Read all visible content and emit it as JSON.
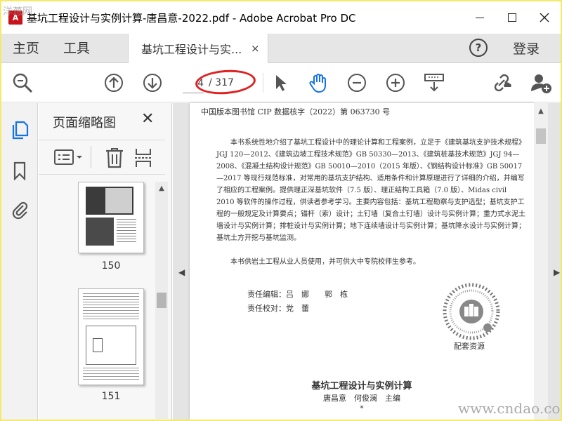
{
  "window": {
    "title": "基坑工程设计与实例计算-唐昌意-2022.pdf - Adobe Acrobat Pro DC",
    "app_icon_label": "A",
    "corner_logo": "洋葱网",
    "controls": [
      "minimize",
      "maximize",
      "close"
    ]
  },
  "menu": {
    "home": "主页",
    "tools": "工具",
    "active_tab": "基坑工程设计与实...",
    "tab_close": "×",
    "help": "?",
    "login": "登录"
  },
  "toolbar": {
    "page_current": "4",
    "page_total": "/ 317",
    "icons": [
      "zoom-search-icon",
      "page-up-icon",
      "page-down-icon",
      "select-arrow-icon",
      "hand-tool-icon",
      "zoom-out-icon",
      "zoom-in-icon",
      "keyboard-fit-icon",
      "share-link-icon",
      "add-user-icon"
    ]
  },
  "thumbnail_panel": {
    "title": "页面缩略图",
    "close": "✕",
    "pages": [
      "150",
      "151"
    ]
  },
  "page": {
    "cip": "中国版本图书馆 CIP 数据核字（2022）第 063730 号",
    "paragraph1": "本书系统性地介绍了基坑工程设计中的理论计算和工程案例，立足于《建筑基坑支护技术规程》JGJ 120—2012、《建筑边坡工程技术规范》GB 50330—2013、《建筑桩基技术规范》JGJ 94—2008、《混凝土结构设计规范》GB 50010—2010（2015 年版）、《钢结构设计标准》GB 50017—2017 等现行规范标准，对常用的基坑支护结构、适用条件和计算原理进行了详细的介绍，并编写了相应的工程案例。提供理正深基坑软件（7.5 版）、理正结构工具箱（7.0 版）、Midas civil 2010 等软件的操作过程，供读者参考学习。主要内容包括：基坑工程勘察与支护选型；基坑支护工程的一般规定及计算要点；锚杆（索）设计；土钉墙（复合土钉墙）设计与实例计算；重力式水泥土墙设计与实例计算；排桩设计与实例计算；地下连续墙设计与实例计算；基坑降水设计与实例计算；基坑土方开挖与基坑监测。",
    "paragraph2": "本书供岩土工程从业人员使用，并可供大中专院校师生参考。",
    "editor_line1": "责任编辑：吕　娜　　郭　栋",
    "editor_line2": "责任校对：党　蕾",
    "qr_caption": "配套资源",
    "book_title": "基坑工程设计与实例计算",
    "book_authors": "唐昌意　何俊澜　主编",
    "asterisk": "*"
  },
  "watermark": "www.cndao.com",
  "colors": {
    "accent_blue": "#1473e6",
    "annotation_red": "#e02020",
    "outer_border": "#f4e96a"
  }
}
